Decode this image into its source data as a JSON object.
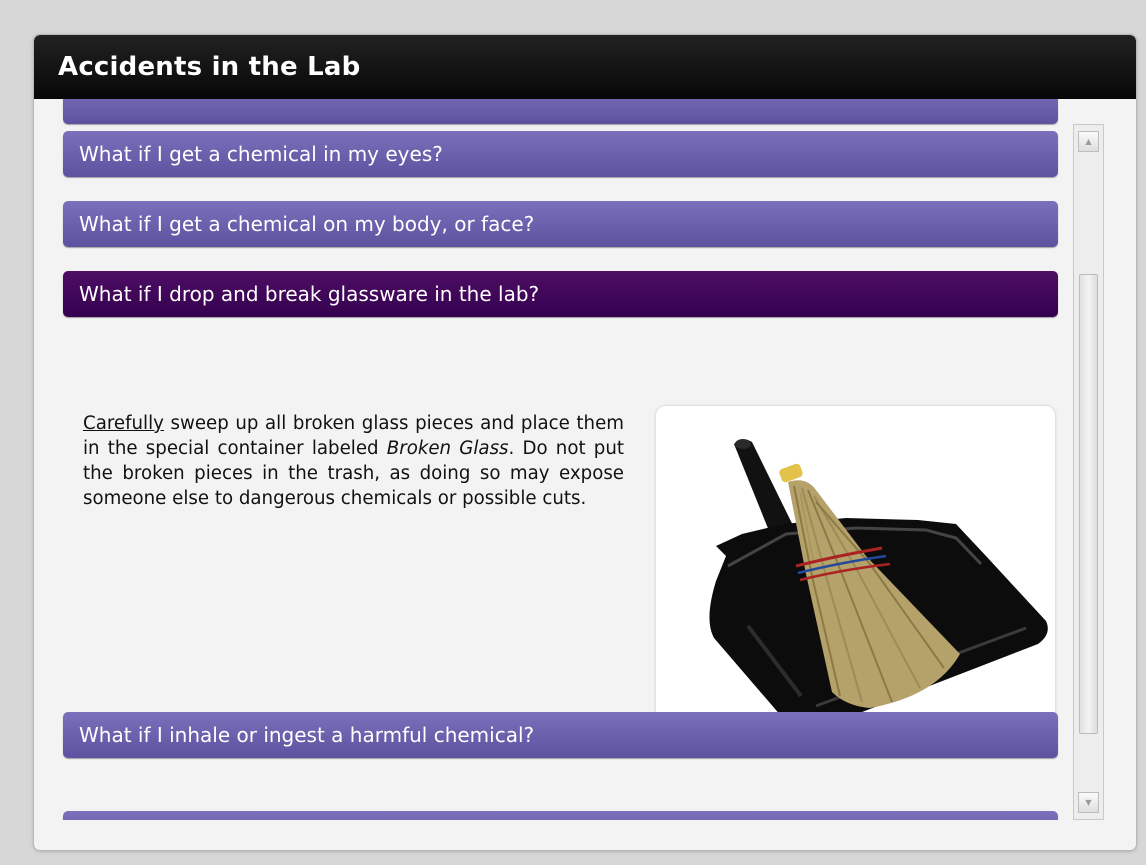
{
  "window": {
    "title": "Accidents in the Lab"
  },
  "accordion": {
    "items": [
      {
        "label": ""
      },
      {
        "label": "What if I get a chemical in my eyes?"
      },
      {
        "label": "What if I get a chemical on my body, or face?"
      },
      {
        "label": "What if I drop and break glassware in the lab?",
        "expanded": true
      },
      {
        "label": "What if I inhale or ingest a harmful chemical?"
      },
      {
        "label": ""
      }
    ]
  },
  "answer": {
    "emph_word": "Carefully",
    "text_1": " sweep up all broken glass pieces and place them in the special container labeled ",
    "italic_label": "Broken Glass",
    "text_2": ". Do not put the broken pieces in the trash, as doing so may expose someone else to dangerous chemicals or possible cuts."
  },
  "image": {
    "subject": "broom-and-dustpan"
  },
  "colors": {
    "accordion": "#6b61ad",
    "accordion_active": "#3a0453",
    "titlebar": "#0d0d0d"
  }
}
